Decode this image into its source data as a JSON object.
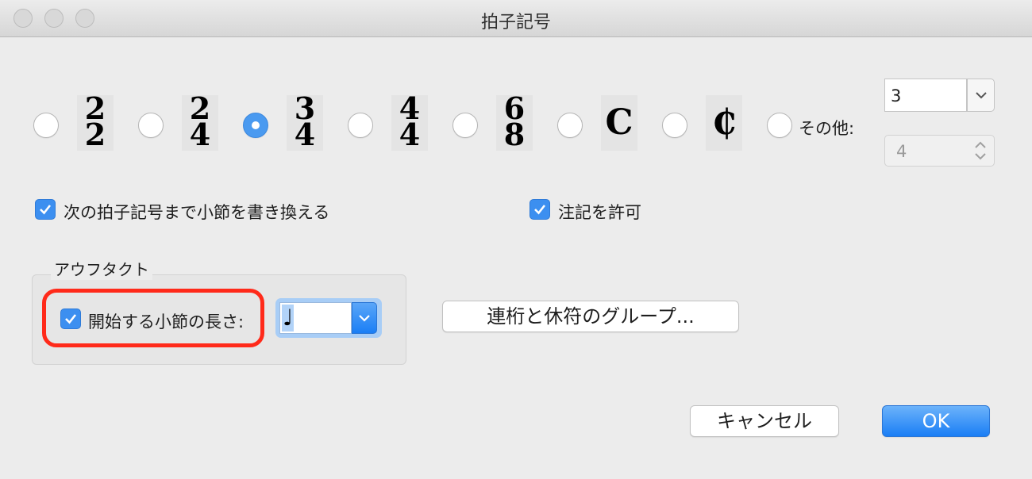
{
  "window": {
    "title": "拍子記号"
  },
  "time_signatures": [
    {
      "top": "2",
      "bottom": "2",
      "selected": false
    },
    {
      "top": "2",
      "bottom": "4",
      "selected": false
    },
    {
      "top": "3",
      "bottom": "4",
      "selected": true
    },
    {
      "top": "4",
      "bottom": "4",
      "selected": false
    },
    {
      "top": "6",
      "bottom": "8",
      "selected": false
    }
  ],
  "symbols": {
    "common": "C",
    "cut": "₵"
  },
  "other": {
    "label": "その他:",
    "numerator_value": "3",
    "denominator_value": "4"
  },
  "options": {
    "rewrite_label": "次の拍子記号まで小節を書き換える",
    "allow_notes_label": "注記を許可"
  },
  "pickup": {
    "group_label": "アウフタクト",
    "start_length_label": "開始する小節の長さ:",
    "note_value": "♩",
    "highlight_color": "#ff2a1a"
  },
  "buttons": {
    "beam_groups": "連桁と休符のグループ...",
    "cancel": "キャンセル",
    "ok": "OK"
  },
  "colors": {
    "accent": "#3c8ff0"
  }
}
